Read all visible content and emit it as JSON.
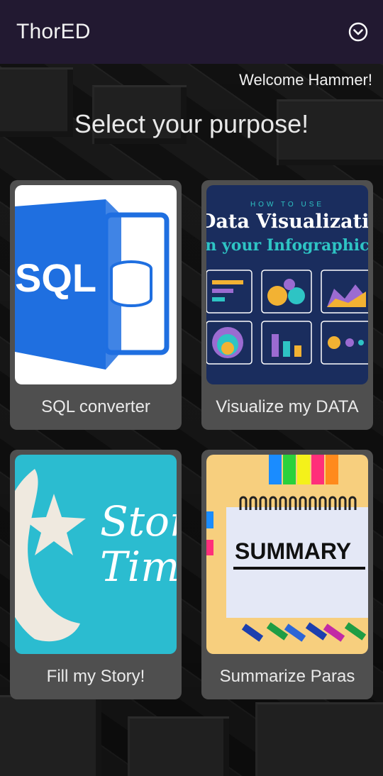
{
  "app": {
    "title": "ThorED",
    "menu_icon": "chevron-down-circle-icon"
  },
  "welcome_text": "Welcome Hammer!",
  "headline": "Select your purpose!",
  "colors": {
    "appbar": "#221931",
    "card": "#4f4f4f",
    "text": "#eaeaea"
  },
  "cards": [
    {
      "label": "SQL converter",
      "image": {
        "icon": "sql-server-logo-icon",
        "text": "SQL"
      }
    },
    {
      "label": "Visualize my DATA",
      "image": {
        "icon": "data-visualization-infographic-icon",
        "kicker": "HOW TO USE",
        "title": "Data Visualization",
        "subtitle": "in your Infographics"
      }
    },
    {
      "label": "Fill my Story!",
      "image": {
        "icon": "moon-star-story-time-icon",
        "line1": "Story",
        "line2": "Time"
      }
    },
    {
      "label": "Summarize Paras",
      "image": {
        "icon": "summary-notebook-icon",
        "text": "SUMMARY"
      }
    }
  ]
}
